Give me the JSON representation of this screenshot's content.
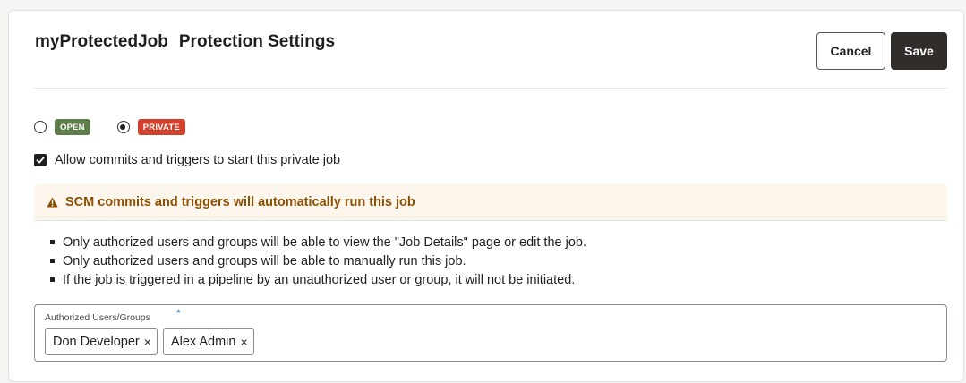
{
  "header": {
    "job_name": "myProtectedJob",
    "page_title": "Protection Settings",
    "cancel_label": "Cancel",
    "save_label": "Save"
  },
  "protection": {
    "options": [
      {
        "label": "OPEN",
        "selected": false,
        "color": "#5e7d4a"
      },
      {
        "label": "PRIVATE",
        "selected": true,
        "color": "#d2402b"
      }
    ]
  },
  "allow_commits": {
    "checked": true,
    "label": "Allow commits and triggers to start this private job"
  },
  "warning": {
    "icon": "warning-triangle-icon",
    "text": "SCM commits and triggers will automatically run this job",
    "color": "#8a4f05"
  },
  "notes": [
    "Only authorized users and groups will be able to view the \"Job Details\" page or edit the job.",
    "Only authorized users and groups will be able to manually run this job.",
    "If the job is triggered in a pipeline by an unauthorized user or group, it will not be initiated."
  ],
  "authorized": {
    "label": "Authorized Users/Groups",
    "required_marker": "*",
    "chips": [
      {
        "label": "Don Developer",
        "remove_glyph": "×"
      },
      {
        "label": "Alex Admin",
        "remove_glyph": "×"
      }
    ]
  }
}
